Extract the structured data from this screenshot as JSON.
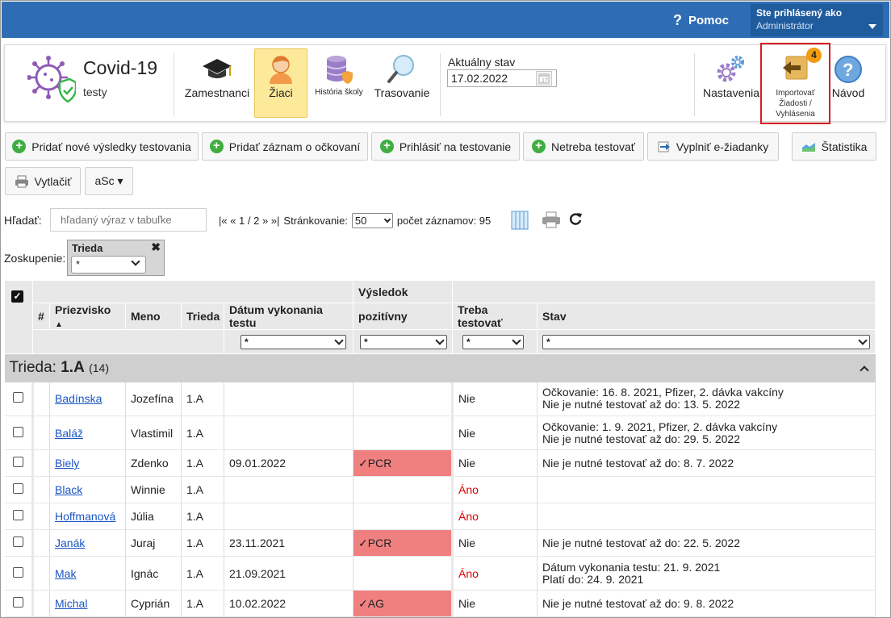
{
  "topbar": {
    "help_label": "Pomoc",
    "logged_as": "Ste prihlásený ako",
    "user": "Administrátor"
  },
  "app": {
    "title": "Covid-19",
    "subtitle": "testy"
  },
  "nav": [
    {
      "label": "Zamestnanci",
      "icon": "graduation-cap-icon"
    },
    {
      "label": "Žiaci",
      "icon": "student-icon"
    },
    {
      "label": "História školy",
      "icon": "database-shield-icon"
    },
    {
      "label": "Trasovanie",
      "icon": "magnifier-icon"
    }
  ],
  "state": {
    "label": "Aktuálny stav",
    "date": "17.02.2022"
  },
  "right_nav": {
    "settings": "Nastavenia",
    "import_label": "Importovať Žiadosti / Vyhlásenia",
    "import_badge": "4",
    "guide": "Návod"
  },
  "toolbar": {
    "add_results": "Pridať nové výsledky testovania",
    "add_vaccine": "Pridať záznam o očkovaní",
    "register_test": "Prihlásiť na testovanie",
    "no_test": "Netreba testovať",
    "fill_form": "Vyplniť e-žiadanky",
    "stats": "Štatistika",
    "print": "Vytlačiť",
    "asc": "aSc ▾"
  },
  "search": {
    "label": "Hľadať:",
    "placeholder": "hľadaný výraz v tabuľke"
  },
  "pager": {
    "nav": "|« « 1 / 2 » »|",
    "paging_label": "Stránkovanie:",
    "page_size": "50",
    "count_label": "počet záznamov: 95"
  },
  "grouping": {
    "label": "Zoskupenie:",
    "group_name": "Trieda",
    "value": "*"
  },
  "table": {
    "columns": {
      "num": "#",
      "surname": "Priezvisko",
      "name": "Meno",
      "class": "Trieda",
      "date": "Dátum vykonania testu",
      "result_group": "Výsledok",
      "result": "pozitívny",
      "need": "Treba testovať",
      "state": "Stav"
    },
    "filter_value": "*",
    "group": {
      "prefix": "Trieda:",
      "name": "1.A",
      "count": "(14)"
    },
    "rows": [
      {
        "surname": "Badínska",
        "name": "Jozefína",
        "class": "1.A",
        "date": "",
        "result": "",
        "need": "Nie",
        "state1": "Očkovanie: 16. 8. 2021, Pfizer, 2. dávka vakcíny",
        "state2": "Nie je nutné testovať až do: 13. 5. 2022"
      },
      {
        "surname": "Baláž",
        "name": "Vlastimil",
        "class": "1.A",
        "date": "",
        "result": "",
        "need": "Nie",
        "state1": "Očkovanie: 1. 9. 2021, Pfizer, 2. dávka vakcíny",
        "state2": "Nie je nutné testovať až do: 29. 5. 2022"
      },
      {
        "surname": "Biely",
        "name": "Zdenko",
        "class": "1.A",
        "date": "09.01.2022",
        "result": "✓PCR",
        "need": "Nie",
        "state1": "Nie je nutné testovať až do: 8. 7. 2022",
        "state2": ""
      },
      {
        "surname": "Black",
        "name": "Winnie",
        "class": "1.A",
        "date": "",
        "result": "",
        "need": "Áno",
        "state1": "",
        "state2": ""
      },
      {
        "surname": "Hoffmanová",
        "name": "Júlia",
        "class": "1.A",
        "date": "",
        "result": "",
        "need": "Áno",
        "state1": "",
        "state2": ""
      },
      {
        "surname": "Janák",
        "name": "Juraj",
        "class": "1.A",
        "date": "23.11.2021",
        "result": "✓PCR",
        "need": "Nie",
        "state1": "Nie je nutné testovať až do: 22. 5. 2022",
        "state2": ""
      },
      {
        "surname": "Mak",
        "name": "Ignác",
        "class": "1.A",
        "date": "21.09.2021",
        "result": "",
        "need": "Áno",
        "state1": "Dátum vykonania testu: 21. 9. 2021",
        "state2": "Platí do: 24. 9. 2021"
      },
      {
        "surname": "Michal",
        "name": "Cyprián",
        "class": "1.A",
        "date": "10.02.2022",
        "result": "✓AG",
        "need": "Nie",
        "state1": "Nie je nutné testovať až do: 9. 8. 2022",
        "state2": ""
      }
    ]
  },
  "colors": {
    "topbar": "#2e6db4",
    "active_tab": "#fde99a",
    "positive": "#f08080",
    "highlight_border": "#d41c24",
    "badge": "#f39c12"
  }
}
